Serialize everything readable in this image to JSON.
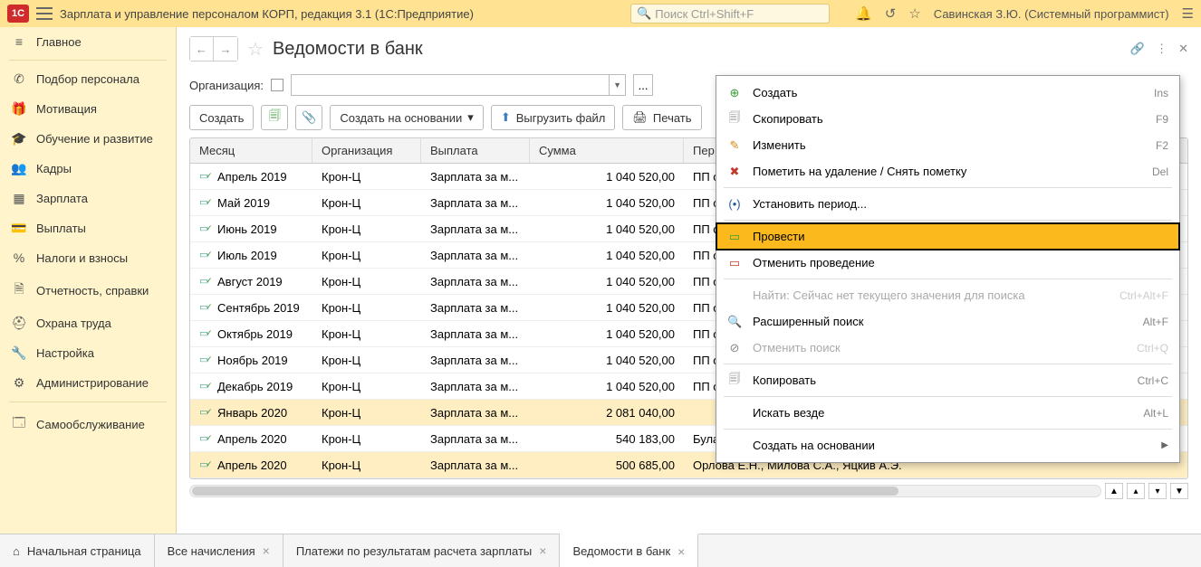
{
  "titlebar": {
    "app_title": "Зарплата и управление персоналом КОРП, редакция 3.1  (1С:Предприятие)",
    "search_placeholder": "Поиск Ctrl+Shift+F",
    "user": "Савинская З.Ю. (Системный программист)"
  },
  "sidebar": {
    "items": [
      {
        "label": "Главное"
      },
      {
        "label": "Подбор персонала"
      },
      {
        "label": "Мотивация"
      },
      {
        "label": "Обучение и развитие"
      },
      {
        "label": "Кадры"
      },
      {
        "label": "Зарплата"
      },
      {
        "label": "Выплаты"
      },
      {
        "label": "Налоги и взносы"
      },
      {
        "label": "Отчетность, справки"
      },
      {
        "label": "Охрана труда"
      },
      {
        "label": "Настройка"
      },
      {
        "label": "Администрирование"
      },
      {
        "label": "Самообслуживание"
      }
    ]
  },
  "page": {
    "title": "Ведомости в банк",
    "filter_label": "Организация:"
  },
  "toolbar": {
    "create": "Создать",
    "create_based": "Создать на основании",
    "export": "Выгрузить файл",
    "print": "Печать"
  },
  "table": {
    "headers": {
      "month": "Месяц",
      "org": "Организация",
      "payment": "Выплата",
      "sum": "Сумма",
      "per": "Пер"
    },
    "rows": [
      {
        "month": "Апрель 2019",
        "org": "Крон-Ц",
        "payment": "Зарплата за м...",
        "sum": "1 040 520,00",
        "per": "ПП о",
        "hl": false
      },
      {
        "month": "Май 2019",
        "org": "Крон-Ц",
        "payment": "Зарплата за м...",
        "sum": "1 040 520,00",
        "per": "ПП о",
        "hl": false
      },
      {
        "month": "Июнь 2019",
        "org": "Крон-Ц",
        "payment": "Зарплата за м...",
        "sum": "1 040 520,00",
        "per": "ПП о",
        "hl": false
      },
      {
        "month": "Июль 2019",
        "org": "Крон-Ц",
        "payment": "Зарплата за м...",
        "sum": "1 040 520,00",
        "per": "ПП о",
        "hl": false
      },
      {
        "month": "Август 2019",
        "org": "Крон-Ц",
        "payment": "Зарплата за м...",
        "sum": "1 040 520,00",
        "per": "ПП о",
        "hl": false
      },
      {
        "month": "Сентябрь 2019",
        "org": "Крон-Ц",
        "payment": "Зарплата за м...",
        "sum": "1 040 520,00",
        "per": "ПП о",
        "hl": false
      },
      {
        "month": "Октябрь 2019",
        "org": "Крон-Ц",
        "payment": "Зарплата за м...",
        "sum": "1 040 520,00",
        "per": "ПП о",
        "hl": false
      },
      {
        "month": "Ноябрь 2019",
        "org": "Крон-Ц",
        "payment": "Зарплата за м...",
        "sum": "1 040 520,00",
        "per": "ПП о",
        "hl": false
      },
      {
        "month": "Декабрь 2019",
        "org": "Крон-Ц",
        "payment": "Зарплата за м...",
        "sum": "1 040 520,00",
        "per": "ПП о",
        "hl": false
      },
      {
        "month": "Январь 2020",
        "org": "Крон-Ц",
        "payment": "Зарплата за м...",
        "sum": "2 081 040,00",
        "per": "",
        "hl": true
      },
      {
        "month": "Апрель 2020",
        "org": "Крон-Ц",
        "payment": "Зарплата за м...",
        "sum": "540 183,00",
        "per": "Булатов И.В., Минчев А.Б., Солодовни",
        "hl": false
      },
      {
        "month": "Апрель 2020",
        "org": "Крон-Ц",
        "payment": "Зарплата за м...",
        "sum": "500 685,00",
        "per": "Орлова Е.Н., Милова С.А., Яцкив А.Э.",
        "hl": true
      }
    ]
  },
  "ctx_menu": {
    "items": [
      {
        "icon": "⊕",
        "iconCls": "green",
        "label": "Создать",
        "shortcut": "Ins"
      },
      {
        "icon": "🗐",
        "iconCls": "gray",
        "label": "Скопировать",
        "shortcut": "F9"
      },
      {
        "icon": "✎",
        "iconCls": "orange",
        "label": "Изменить",
        "shortcut": "F2"
      },
      {
        "icon": "✖",
        "iconCls": "red",
        "label": "Пометить на удаление / Снять пометку",
        "shortcut": "Del"
      },
      {
        "divider": true
      },
      {
        "icon": "(•)",
        "iconCls": "darkblue",
        "label": "Установить период...",
        "shortcut": ""
      },
      {
        "divider": true
      },
      {
        "icon": "▭",
        "iconCls": "green",
        "label": "Провести",
        "shortcut": "",
        "highlighted": true
      },
      {
        "icon": "▭",
        "iconCls": "red",
        "label": "Отменить проведение",
        "shortcut": ""
      },
      {
        "divider": true
      },
      {
        "icon": "",
        "iconCls": "",
        "label": "Найти: Сейчас нет текущего значения для поиска",
        "shortcut": "Ctrl+Alt+F",
        "disabled": true
      },
      {
        "icon": "🔍",
        "iconCls": "gray",
        "label": "Расширенный поиск",
        "shortcut": "Alt+F"
      },
      {
        "icon": "⊘",
        "iconCls": "gray",
        "label": "Отменить поиск",
        "shortcut": "Ctrl+Q",
        "disabled": true
      },
      {
        "divider": true
      },
      {
        "icon": "🗐",
        "iconCls": "gray",
        "label": "Копировать",
        "shortcut": "Ctrl+C"
      },
      {
        "divider": true
      },
      {
        "icon": "",
        "iconCls": "",
        "label": "Искать везде",
        "shortcut": "Alt+L"
      },
      {
        "divider": true
      },
      {
        "icon": "",
        "iconCls": "",
        "label": "Создать на основании",
        "shortcut": "",
        "submenu": true
      }
    ]
  },
  "bottom_tabs": {
    "home": "Начальная страница",
    "tabs": [
      {
        "label": "Все начисления"
      },
      {
        "label": "Платежи по результатам расчета зарплаты"
      },
      {
        "label": "Ведомости в банк",
        "active": true
      }
    ]
  }
}
